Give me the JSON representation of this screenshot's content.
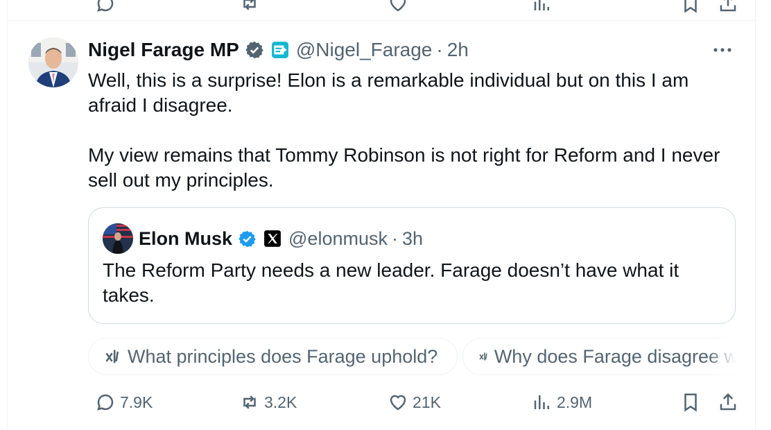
{
  "tweet": {
    "author_name": "Nigel Farage MP",
    "handle": "@Nigel_Farage",
    "separator": "·",
    "time": "2h",
    "text_paragraphs": [
      "Well, this is a surprise! Elon is a remarkable individual but on this I am afraid I disagree.",
      "My view remains that Tommy Robinson is not right for Reform and I never sell out my principles."
    ]
  },
  "quoted_tweet": {
    "author_name": "Elon Musk",
    "handle": "@elonmusk",
    "separator": "·",
    "time": "3h",
    "text": "The Reform Party needs a new leader. Farage doesn’t have what it takes."
  },
  "grok_chips": [
    "What principles does Farage uphold?",
    "Why does Farage disagree w"
  ],
  "actions": {
    "replies": "7.9K",
    "reposts": "3.2K",
    "likes": "21K",
    "views": "2.9M"
  },
  "colors": {
    "verified_blue": "#1d9bf0",
    "text_primary": "#0f1419",
    "text_secondary": "#536471",
    "border": "#cfd9de",
    "reform_cyan": "#12b6cf"
  },
  "icons": [
    "verified-badge-icon",
    "reform-uk-affiliate-icon",
    "x-logo-icon",
    "more-icon",
    "grok-icon",
    "reply-icon",
    "repost-icon",
    "like-icon",
    "views-icon",
    "bookmark-icon",
    "share-icon"
  ]
}
